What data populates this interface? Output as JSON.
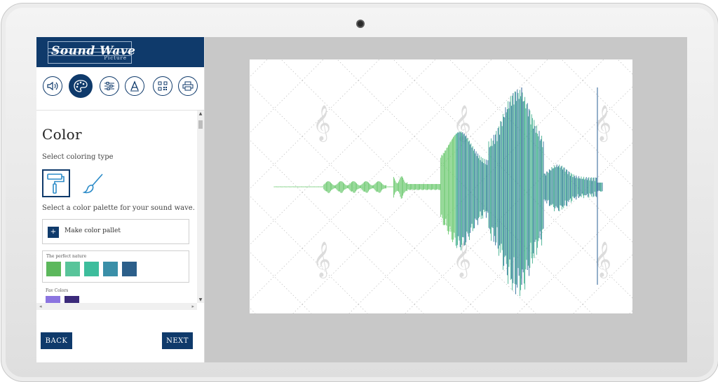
{
  "app": {
    "logo_text": "Sound Wave",
    "logo_subtext": "Picture"
  },
  "toolbar": {
    "tools": [
      {
        "name": "sound-icon",
        "active": false
      },
      {
        "name": "palette-icon",
        "active": true
      },
      {
        "name": "sliders-icon",
        "active": false
      },
      {
        "name": "text-icon",
        "active": false
      },
      {
        "name": "qr-code-icon",
        "active": false
      },
      {
        "name": "printer-icon",
        "active": false
      }
    ]
  },
  "color_section": {
    "title": "Color",
    "coloring_type_label": "Select coloring type",
    "coloring_types": [
      {
        "name": "paint-roller-icon",
        "selected": true
      },
      {
        "name": "paint-brush-icon",
        "selected": false
      }
    ],
    "palette_prompt": "Select a color palette for your sound wave.",
    "make_palette_label": "Make color pallet",
    "make_palette_plus": "+",
    "palettes": [
      {
        "name": "The perfect nature",
        "colors": [
          "#5cb85c",
          "#58c49a",
          "#3dbd9c",
          "#3a8fa8",
          "#2c5f8a"
        ]
      },
      {
        "name": "Fav Colors",
        "colors": [
          "#8b74e0",
          "#3b2a7a"
        ]
      }
    ]
  },
  "nav": {
    "back_label": "BACK",
    "next_label": "NEXT"
  },
  "scrollbar": {
    "up_arrow": "▲",
    "down_arrow": "▼",
    "left_arrow": "◂",
    "right_arrow": "▸"
  },
  "preview": {
    "background": "#ffffff",
    "pattern": "dotted-diamond-grid",
    "watermark": "treble-clef-icon",
    "wave_gradient": [
      "#6fcf6a",
      "#3fb59a",
      "#2f7fa6",
      "#2a4f8a"
    ]
  },
  "colors": {
    "brand": "#0f3a6b",
    "screen_bg": "#c8c8c8"
  }
}
